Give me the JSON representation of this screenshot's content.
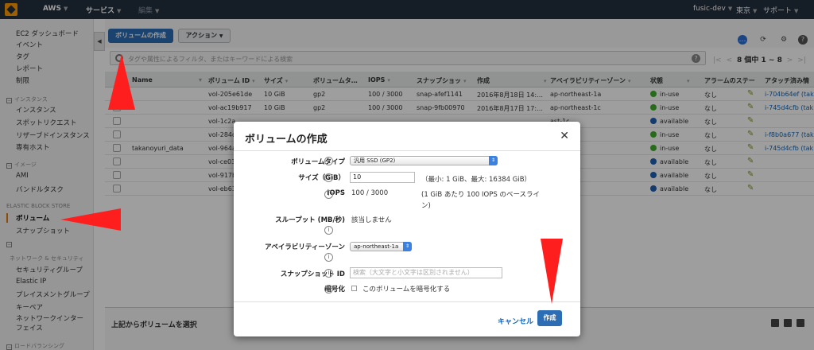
{
  "topbar": {
    "brand": "AWS",
    "services": "サービス",
    "edit": "編集",
    "account": "fusic-dev",
    "region": "東京",
    "support": "サポート"
  },
  "sidebar": {
    "items": [
      {
        "label": "EC2 ダッシュボード"
      },
      {
        "label": "イベント"
      },
      {
        "label": "タグ"
      },
      {
        "label": "レポート"
      },
      {
        "label": "制限"
      }
    ],
    "sections": [
      {
        "header": "インスタンス",
        "items": [
          "インスタンス",
          "スポットリクエスト",
          "リザーブドインスタンス",
          "専有ホスト"
        ]
      },
      {
        "header": "イメージ",
        "items": [
          "AMI",
          "バンドルタスク"
        ]
      },
      {
        "header": "ELASTIC BLOCK STORE",
        "items": [
          "ボリューム",
          "スナップショット"
        ]
      },
      {
        "header": "ネットワーク & セキュリティ",
        "items": [
          "セキュリティグループ",
          "Elastic IP",
          "プレイスメントグループ",
          "キーペア",
          "ネットワークインターフェイス"
        ]
      },
      {
        "header": "ロードバランシング",
        "items": []
      }
    ],
    "active": "ボリューム"
  },
  "toolbar": {
    "create_button": "ボリュームの作成",
    "actions_button": "アクション"
  },
  "filter": {
    "placeholder": "タグや属性によるフィルタ、またはキーワードによる検索",
    "pager": "8 個中 1 ~ 8"
  },
  "table": {
    "columns": [
      "Name",
      "ボリューム ID",
      "サイズ",
      "ボリュームタ…",
      "IOPS",
      "スナップショッ",
      "作成",
      "アベイラビリティーゾーン",
      "状態",
      "アラームのステー",
      "アタッチ済み情"
    ],
    "rows": [
      {
        "name": "",
        "id": "vol-205e61de",
        "size": "10 GiB",
        "type": "gp2",
        "iops": "100 / 3000",
        "snapshot": "snap-afef1141",
        "created": "2016年8月18日 14:…",
        "az": "ap-northeast-1a",
        "state": "in-use",
        "state_color": "green",
        "alarm": "なし",
        "attach": "i-704b64ef (tak"
      },
      {
        "name": "",
        "id": "vol-ac19b917",
        "size": "10 GiB",
        "type": "gp2",
        "iops": "100 / 3000",
        "snapshot": "snap-9fb00970",
        "created": "2016年8月17日 17:…",
        "az": "ap-northeast-1c",
        "state": "in-use",
        "state_color": "green",
        "alarm": "なし",
        "attach": "i-745d4cfb (tak"
      },
      {
        "name": "",
        "id": "vol-1c2a",
        "size": "",
        "type": "",
        "iops": "",
        "snapshot": "",
        "created": "",
        "az": "ast-1c",
        "state": "available",
        "state_color": "blue",
        "alarm": "なし",
        "attach": ""
      },
      {
        "name": "",
        "id": "vol-284d",
        "size": "",
        "type": "",
        "iops": "",
        "snapshot": "",
        "created": "",
        "az": "ast-1c",
        "state": "in-use",
        "state_color": "green",
        "alarm": "なし",
        "attach": "i-f8b0a677 (tak"
      },
      {
        "name": "takanoyuri_data",
        "id": "vol-964a",
        "size": "",
        "type": "",
        "iops": "",
        "snapshot": "",
        "created": "",
        "az": "ast-1c",
        "state": "in-use",
        "state_color": "green",
        "alarm": "なし",
        "attach": "i-745d4cfb (tak"
      },
      {
        "name": "",
        "id": "vol-ce03",
        "size": "",
        "type": "",
        "iops": "",
        "snapshot": "",
        "created": "",
        "az": "ast-1c",
        "state": "available",
        "state_color": "blue",
        "alarm": "なし",
        "attach": ""
      },
      {
        "name": "",
        "id": "vol-917b",
        "size": "",
        "type": "",
        "iops": "",
        "snapshot": "",
        "created": "",
        "az": "ast-1c",
        "state": "available",
        "state_color": "blue",
        "alarm": "なし",
        "attach": ""
      },
      {
        "name": "",
        "id": "vol-eb63",
        "size": "",
        "type": "",
        "iops": "",
        "snapshot": "",
        "created": "",
        "az": "ast-1c",
        "state": "available",
        "state_color": "blue",
        "alarm": "なし",
        "attach": ""
      }
    ]
  },
  "detail": {
    "prompt": "上記からボリュームを選択"
  },
  "modal": {
    "title": "ボリュームの作成",
    "volume_type_label": "ボリュームタイプ",
    "volume_type_value": "汎用 SSD (GP2)",
    "size_label": "サイズ（GiB）",
    "size_value": "10",
    "size_hint": "（最小: 1 GiB、最大: 16384 GiB）",
    "iops_label": "IOPS",
    "iops_value": "100 / 3000",
    "iops_hint_1": "(1 GiB あたり 100 IOPS のベースライ",
    "iops_hint_2": "ン)",
    "throughput_label": "スループット (MB/秒)",
    "throughput_value": "該当しません",
    "az_label": "アベイラビリティーゾーン",
    "az_value": "ap-northeast-1a",
    "snapshot_label": "スナップショット ID",
    "snapshot_placeholder": "検索（大文字と小文字は区別されません）",
    "encrypt_label": "暗号化",
    "encrypt_checkbox_label": "このボリュームを暗号化する",
    "cancel": "キャンセル",
    "create": "作成"
  },
  "colors": {
    "topbar": "#232f3e",
    "primary": "#2c6db3",
    "arrow": "#ff1e1e",
    "link": "#1166bb"
  }
}
